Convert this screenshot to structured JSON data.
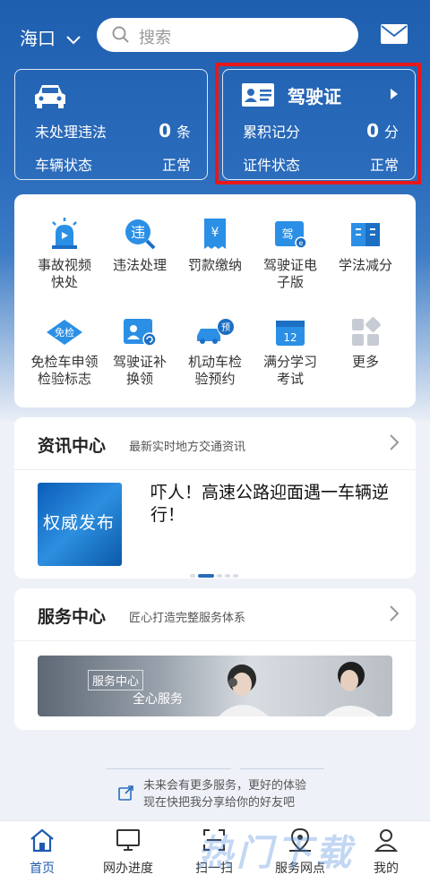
{
  "header": {
    "city": "海口",
    "search_placeholder": "搜索"
  },
  "vehicle_card": {
    "violations_label": "未处理违法",
    "violations_count": "0",
    "violations_unit": "条",
    "status_label": "车辆状态",
    "status_value": "正常"
  },
  "license_card": {
    "title": "驾驶证",
    "points_label": "累积记分",
    "points_value": "0",
    "points_unit": "分",
    "status_label": "证件状态",
    "status_value": "正常"
  },
  "services": [
    {
      "label": "事故视频快处",
      "icon": "police-light-icon"
    },
    {
      "label": "违法处理",
      "icon": "violation-search-icon"
    },
    {
      "label": "罚款缴纳",
      "icon": "payment-receipt-icon"
    },
    {
      "label": "驾驶证电子版",
      "icon": "e-license-icon"
    },
    {
      "label": "学法减分",
      "icon": "book-icon"
    },
    {
      "label": "免检车申领检验标志",
      "icon": "exempt-badge-icon"
    },
    {
      "label": "驾驶证补换领",
      "icon": "license-renew-icon"
    },
    {
      "label": "机动车检验预约",
      "icon": "inspection-booking-icon"
    },
    {
      "label": "满分学习考试",
      "icon": "calendar-exam-icon"
    },
    {
      "label": "更多",
      "icon": "more-grid-icon"
    }
  ],
  "service_labels_lines": [
    [
      "事故视频",
      "快处"
    ],
    [
      "违法处理"
    ],
    [
      "罚款缴纳"
    ],
    [
      "驾驶证电",
      "子版"
    ],
    [
      "学法减分"
    ],
    [
      "免检车申领",
      "检验标志"
    ],
    [
      "驾驶证补",
      "换领"
    ],
    [
      "机动车检",
      "验预约"
    ],
    [
      "满分学习",
      "考试"
    ],
    [
      "更多"
    ]
  ],
  "news": {
    "title": "资讯中心",
    "subtitle": "最新实时地方交通资讯",
    "image_text": "权威发布",
    "headline": "吓人！高速公路迎面遇一车辆逆行！"
  },
  "service_center": {
    "title": "服务中心",
    "subtitle": "匠心打造完整服务体系",
    "banner_tag": "服务中心",
    "banner_text": "全心服务"
  },
  "share": {
    "line1": "未来会有更多服务，更好的体验",
    "line2": "现在快把我分享给你的好友吧"
  },
  "tabs": [
    {
      "label": "首页",
      "icon": "home-icon",
      "active": true
    },
    {
      "label": "网办进度",
      "icon": "monitor-icon"
    },
    {
      "label": "扫一扫",
      "icon": "scan-icon"
    },
    {
      "label": "服务网点",
      "icon": "map-pin-icon"
    },
    {
      "label": "我的",
      "icon": "user-icon"
    }
  ],
  "watermark": "热门下载",
  "colors": {
    "primary": "#1f5fb0",
    "highlight_box": "#e8181a"
  }
}
